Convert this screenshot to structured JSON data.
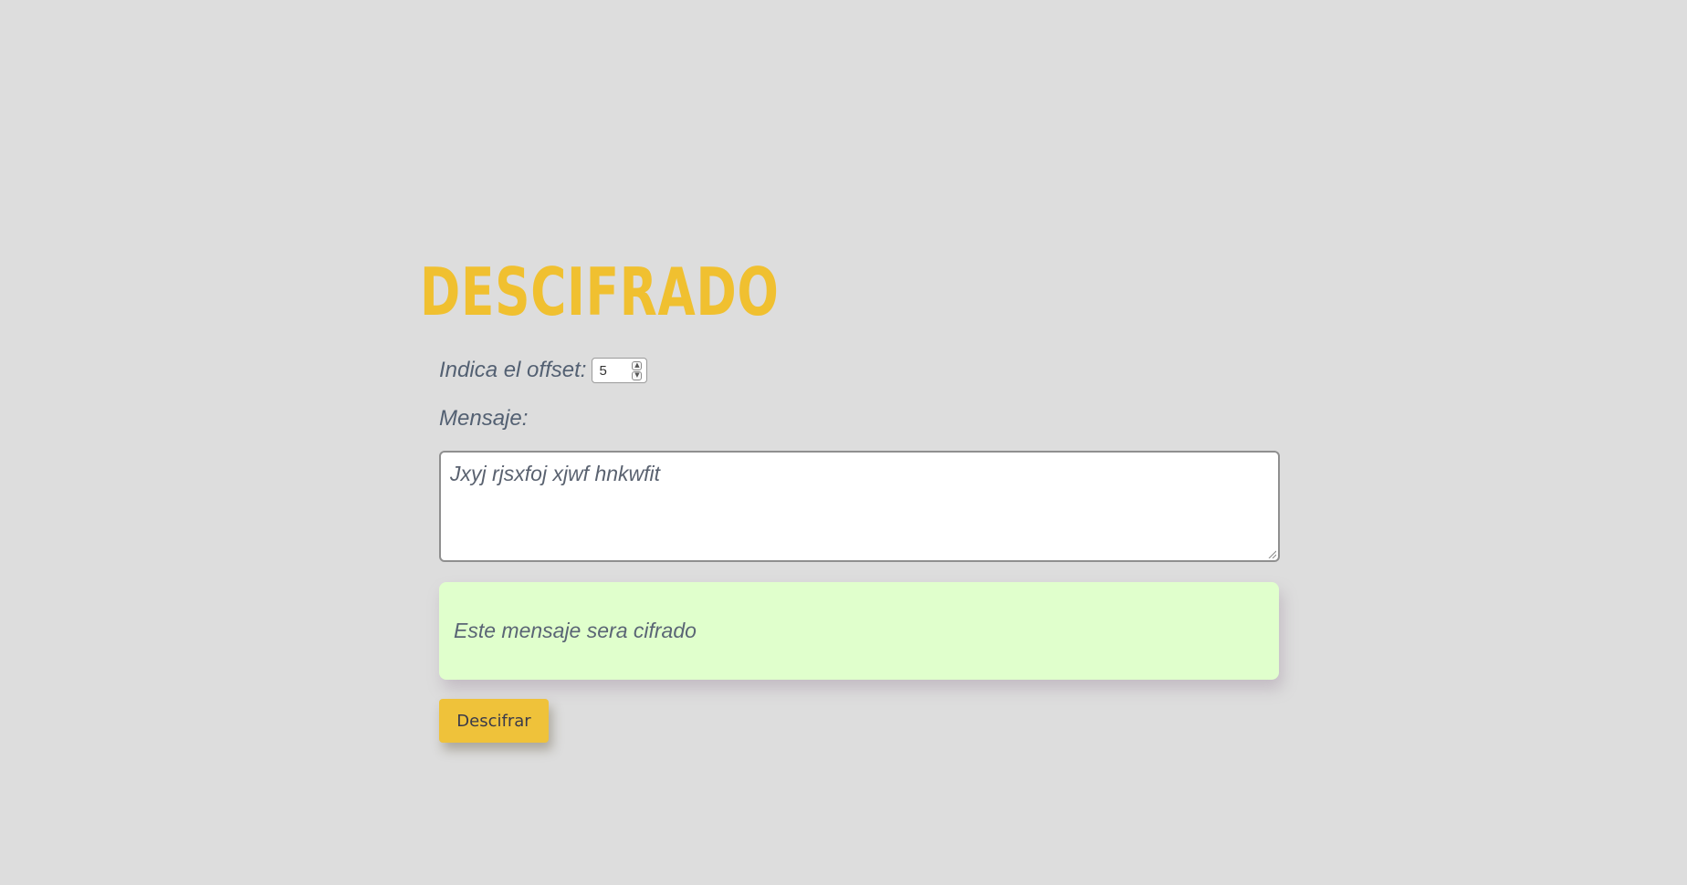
{
  "page": {
    "title": "DESCIFRADO"
  },
  "offset": {
    "label": "Indica el offset:",
    "value": "5"
  },
  "message": {
    "label": "Mensaje:",
    "value": "Jxyj rjsxfoj xjwf hnkwfit"
  },
  "result": {
    "text": "Este mensaje sera cifrado"
  },
  "actions": {
    "decrypt_label": "Descifrar"
  },
  "colors": {
    "background": "#dddddd",
    "title": "#f0c030",
    "label": "#536072",
    "result_background": "#e0ffcc",
    "button": "#efc23a"
  },
  "icons": {
    "spin_up": "chevron-up-icon",
    "spin_down": "chevron-down-icon",
    "resize": "resize-grip-icon"
  }
}
